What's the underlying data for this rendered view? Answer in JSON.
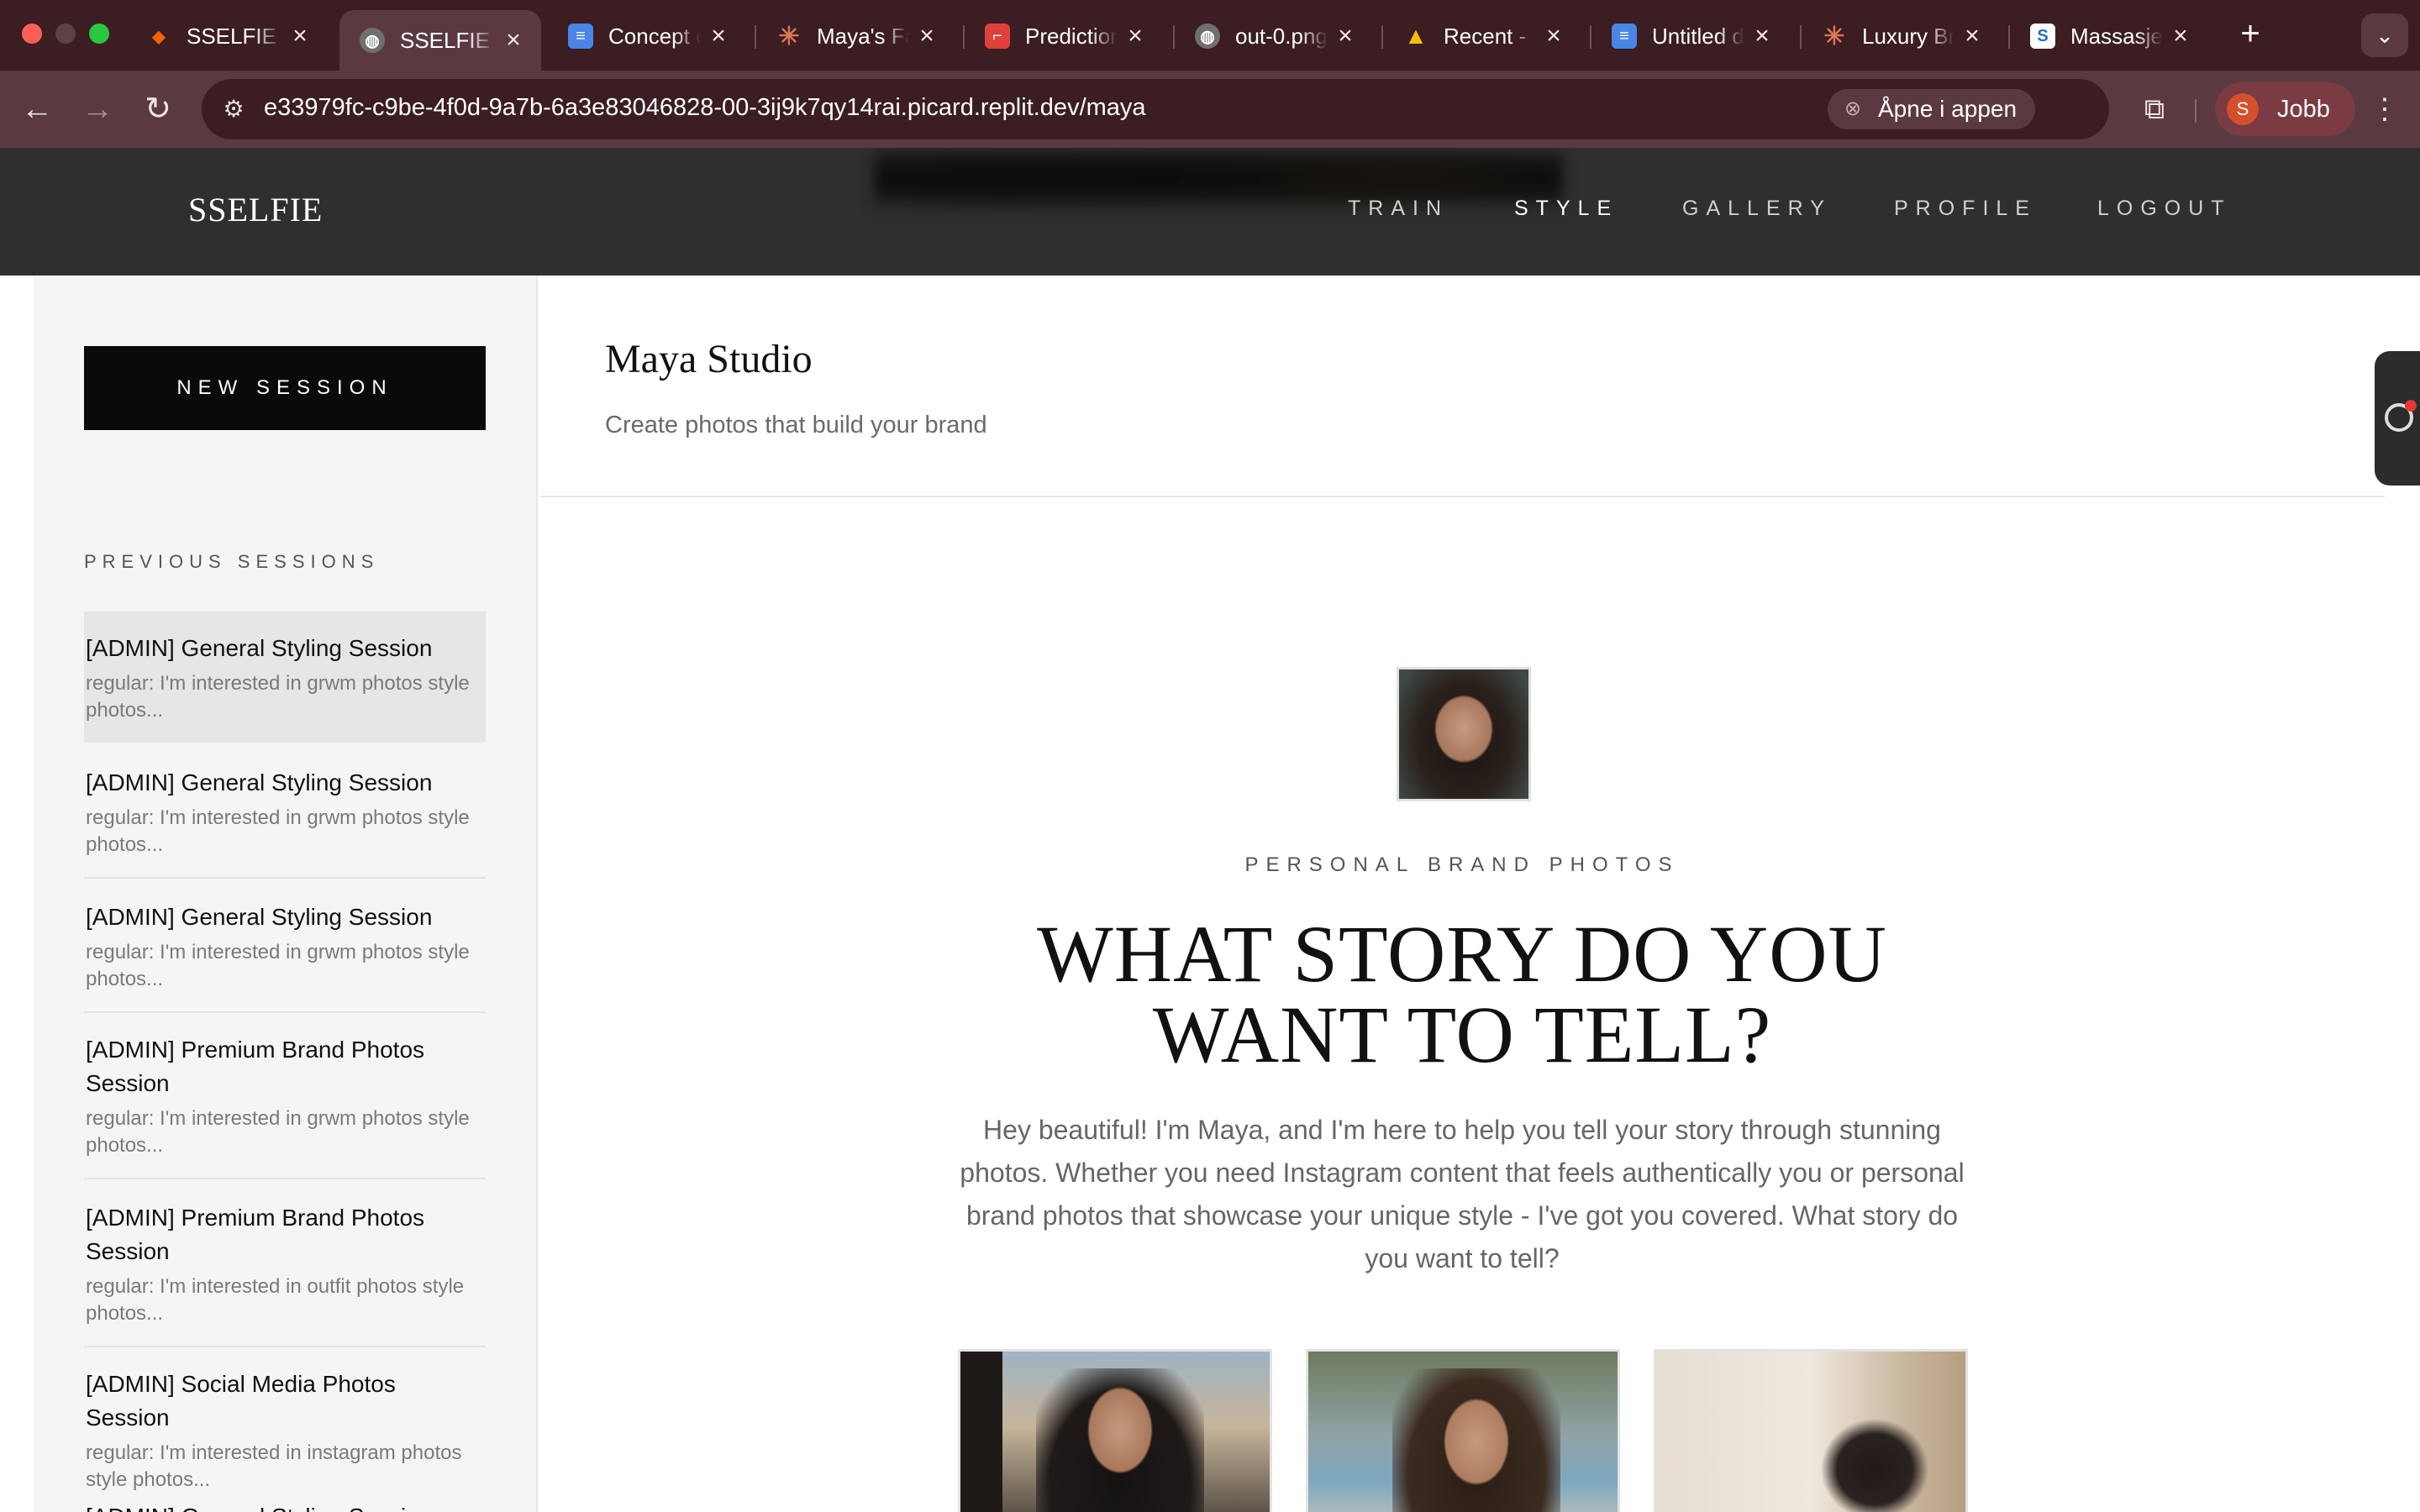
{
  "browser": {
    "tabs": [
      {
        "title": "SSELFIE S",
        "favicon": "replit-icon",
        "favicon_color": "#f26207"
      },
      {
        "title": "SSELFIE S",
        "favicon": "globe-icon",
        "favicon_color": "#5a3a40",
        "active": true
      },
      {
        "title": "Concept c",
        "favicon": "docs-icon",
        "favicon_color": "#4a86e8"
      },
      {
        "title": "Maya's Fa",
        "favicon": "claude-icon",
        "favicon_color": "#d97757"
      },
      {
        "title": "Prediction",
        "favicon": "replicate-icon",
        "favicon_color": "#e0403c"
      },
      {
        "title": "out-0.png",
        "favicon": "globe-icon",
        "favicon_color": "#3b1d22"
      },
      {
        "title": "Recent - ",
        "favicon": "drive-icon",
        "favicon_color": "#fbbc04"
      },
      {
        "title": "Untitled d",
        "favicon": "docs-icon",
        "favicon_color": "#4a86e8"
      },
      {
        "title": "Luxury Br",
        "favicon": "claude-icon",
        "favicon_color": "#d97757"
      },
      {
        "title": "Massasje",
        "favicon": "s-logo-icon",
        "favicon_color": "#ffffff"
      }
    ],
    "url": "e33979fc-c9be-4f0d-9a7b-6a3e83046828-00-3ij9k7qy14rai.picard.replit.dev/maya",
    "open_in_app_label": "Åpne i appen",
    "profile_initial": "S",
    "profile_label": "Jobb"
  },
  "site": {
    "logo": "SSELFIE",
    "nav": [
      {
        "label": "TRAIN"
      },
      {
        "label": "STYLE",
        "active": true
      },
      {
        "label": "GALLERY"
      },
      {
        "label": "PROFILE"
      },
      {
        "label": "LOGOUT"
      }
    ]
  },
  "sidebar": {
    "new_session_label": "NEW SESSION",
    "previous_sessions_label": "PREVIOUS SESSIONS",
    "sessions": [
      {
        "title": "[ADMIN] General Styling Session",
        "subtitle": "regular: I'm interested in grwm photos style photos...",
        "selected": true
      },
      {
        "title": "[ADMIN] General Styling Session",
        "subtitle": "regular: I'm interested in grwm photos style photos..."
      },
      {
        "title": "[ADMIN] General Styling Session",
        "subtitle": "regular: I'm interested in grwm photos style photos..."
      },
      {
        "title": "[ADMIN] Premium Brand Photos Session",
        "subtitle": "regular: I'm interested in grwm photos style photos..."
      },
      {
        "title": "[ADMIN] Premium Brand Photos Session",
        "subtitle": "regular: I'm interested in outfit photos style photos..."
      },
      {
        "title": "[ADMIN] Social Media Photos Session",
        "subtitle": "regular: I'm interested in instagram photos style photos..."
      },
      {
        "title": "[ADMIN] General Styling Session",
        "subtitle": ""
      }
    ]
  },
  "main": {
    "title": "Maya Studio",
    "subtitle": "Create photos that build your brand",
    "kicker": "PERSONAL BRAND PHOTOS",
    "headline_line1": "WHAT STORY DO YOU",
    "headline_line2": "WANT TO TELL?",
    "intro": "Hey beautiful! I'm Maya, and I'm here to help you tell your story through stunning photos. Whether you need Instagram content that feels authentically you or personal brand photos that showcase your unique style - I've got you covered. What story do you want to tell?"
  },
  "colors": {
    "tabbar_bg": "#3b1d22",
    "toolbar_bg": "#5a3a40",
    "site_header_bg": "#2f2f2f",
    "sidebar_bg": "#f5f5f5",
    "accent_black": "#0a0a0a"
  }
}
